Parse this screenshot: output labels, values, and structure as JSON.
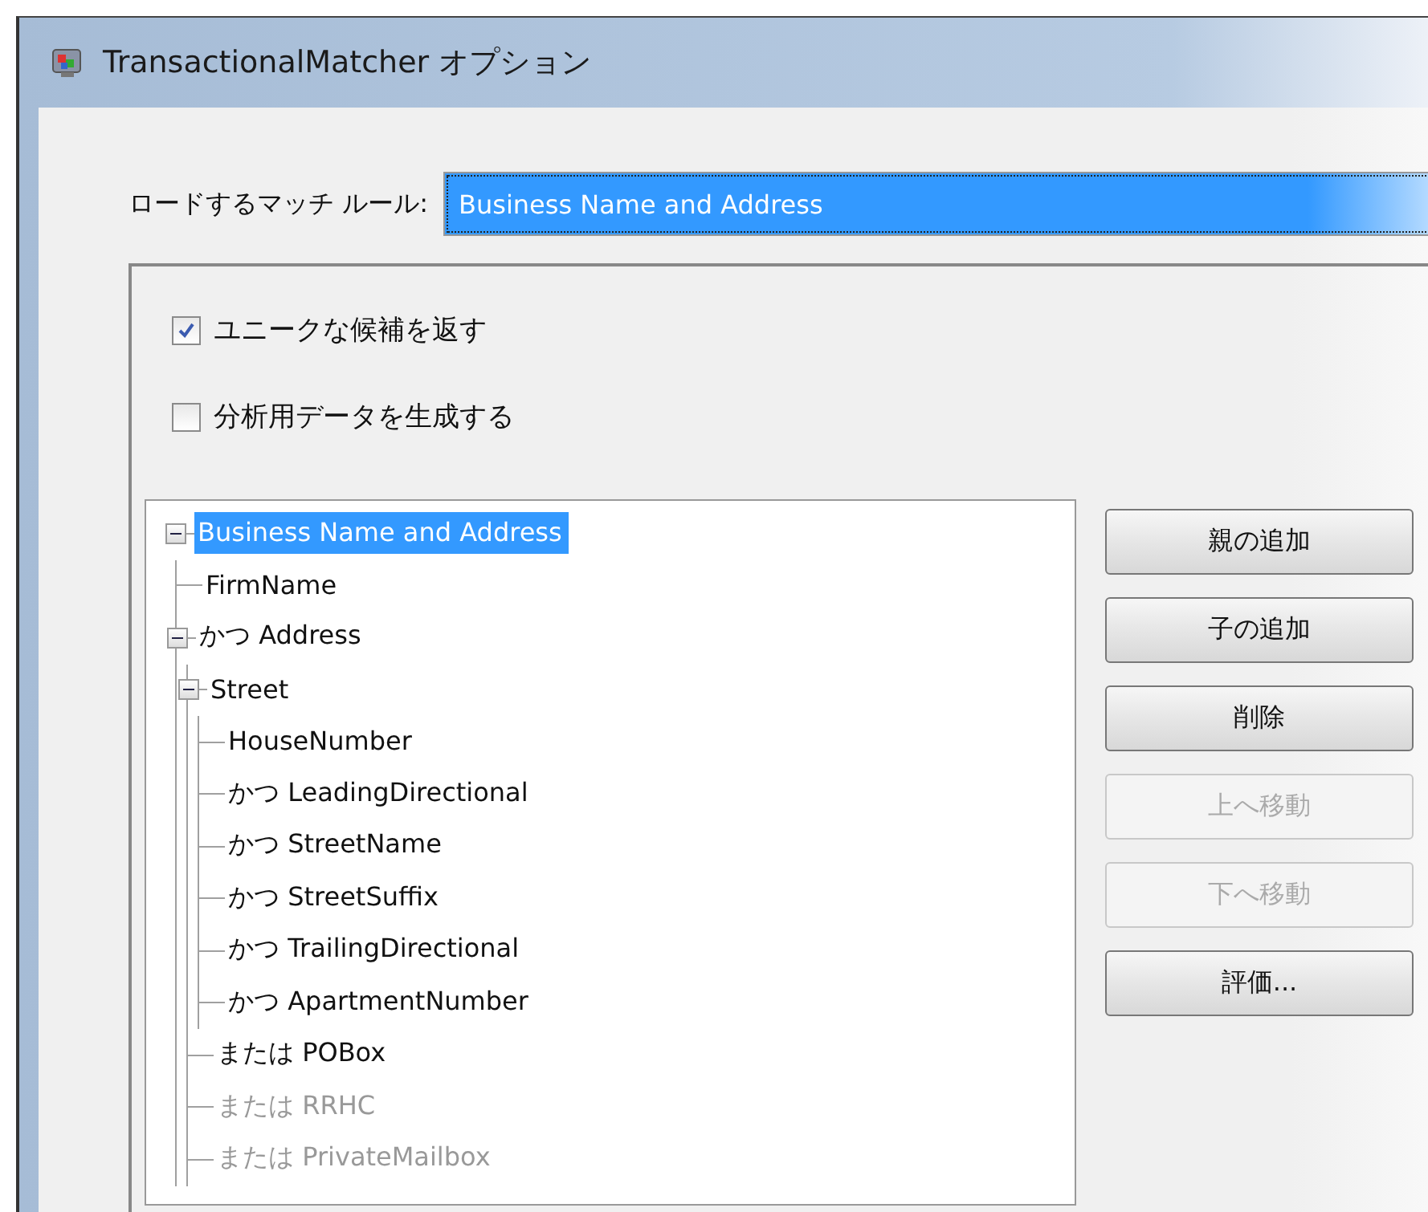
{
  "window": {
    "title": "TransactionalMatcher オプション"
  },
  "rule_select": {
    "label": "ロードするマッチ ルール:",
    "value": "Business Name and Address"
  },
  "options": [
    {
      "label": "ユニークな候補を返す",
      "checked": true
    },
    {
      "label": "分析用データを生成する",
      "checked": false
    }
  ],
  "tree": [
    {
      "label": "Business Name and Address",
      "selected": true,
      "expanded": true,
      "disabled": false,
      "children": [
        {
          "label": "FirmName",
          "selected": false,
          "disabled": false
        },
        {
          "label": "かつ Address",
          "selected": false,
          "expanded": true,
          "disabled": false,
          "children": [
            {
              "label": "Street",
              "selected": false,
              "expanded": true,
              "disabled": false,
              "children": [
                {
                  "label": "HouseNumber",
                  "selected": false,
                  "disabled": false
                },
                {
                  "label": "かつ LeadingDirectional",
                  "selected": false,
                  "disabled": false
                },
                {
                  "label": "かつ StreetName",
                  "selected": false,
                  "disabled": false
                },
                {
                  "label": "かつ StreetSuffix",
                  "selected": false,
                  "disabled": false
                },
                {
                  "label": "かつ TrailingDirectional",
                  "selected": false,
                  "disabled": false
                },
                {
                  "label": "かつ ApartmentNumber",
                  "selected": false,
                  "disabled": false
                }
              ]
            },
            {
              "label": "または POBox",
              "selected": false,
              "disabled": false
            },
            {
              "label": "または RRHC",
              "selected": false,
              "disabled": true
            },
            {
              "label": "または PrivateMailbox",
              "selected": false,
              "disabled": true
            }
          ]
        }
      ]
    }
  ],
  "buttons": [
    {
      "label": "親の追加",
      "disabled": false
    },
    {
      "label": "子の追加",
      "disabled": false
    },
    {
      "label": "削除",
      "disabled": false
    },
    {
      "label": "上へ移動",
      "disabled": true
    },
    {
      "label": "下へ移動",
      "disabled": true
    },
    {
      "label": "評価...",
      "disabled": false
    }
  ]
}
